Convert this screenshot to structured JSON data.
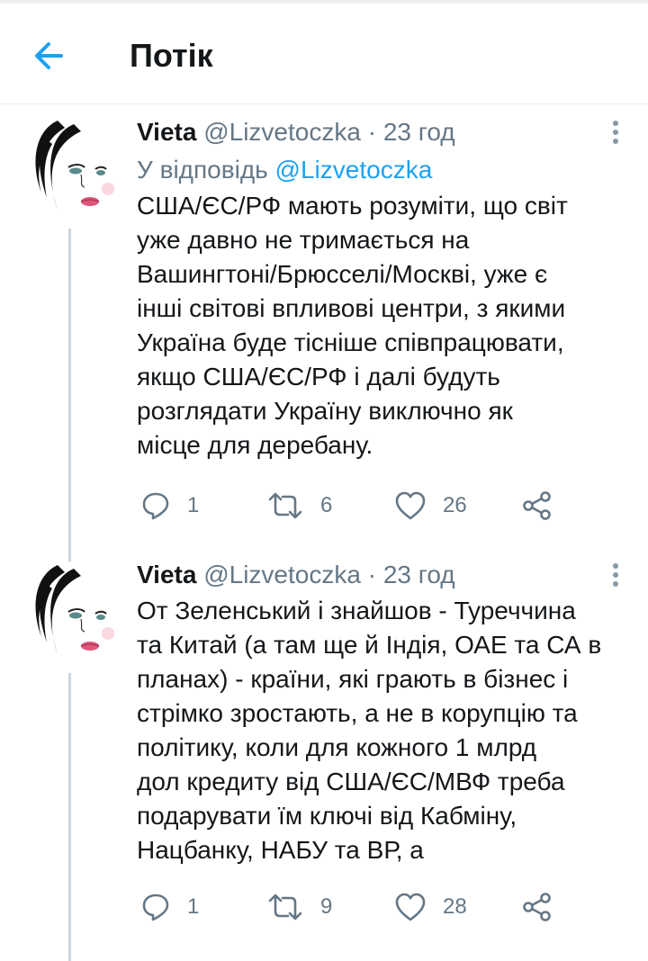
{
  "header": {
    "title": "Потік"
  },
  "tweets": [
    {
      "author_name": "Vieta",
      "author_handle": "@Lizvetoczka",
      "separator": "·",
      "time": "23 год",
      "reply_prefix": "У відповідь",
      "reply_handle": "@Lizvetoczka",
      "text_lines": [
        "США/ЄС/РФ мають розуміти, що світ",
        "уже давно не тримається на",
        "Вашингтоні/Брюсселі/Москві, уже є",
        "інші світові впливові центри, з якими",
        "Україна буде тісніше співпрацювати,",
        "якщо США/ЄС/РФ і далі будуть",
        "розглядати Україну виключно як",
        "місце для деребану."
      ],
      "replies": "1",
      "retweets": "6",
      "likes": "26"
    },
    {
      "author_name": "Vieta",
      "author_handle": "@Lizvetoczka",
      "separator": "·",
      "time": "23 год",
      "text_lines": [
        "От Зеленський і знайшов - Туреччина",
        "та Китай (а там ще й Індія, ОАЕ та СА в",
        "планах) - країни, які грають в бізнес і",
        "стрімко зростають, а не в корупцію та",
        "політику, коли для кожного 1 млрд",
        "дол кредиту від США/ЄС/МВФ треба",
        "подарувати їм ключі від Кабміну,",
        "Нацбанку, НАБУ та ВР, а"
      ],
      "replies": "1",
      "retweets": "9",
      "likes": "28"
    }
  ],
  "colors": {
    "accent": "#1da1f2",
    "muted": "#657786",
    "text": "#14171a",
    "thread": "#ccd6dd"
  },
  "icons": [
    "back-arrow-icon",
    "more-icon",
    "reply-icon",
    "retweet-icon",
    "like-icon",
    "share-icon"
  ]
}
